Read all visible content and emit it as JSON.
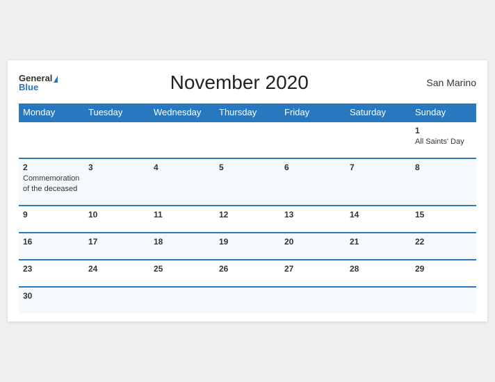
{
  "header": {
    "logo_general": "General",
    "logo_blue": "Blue",
    "title": "November 2020",
    "region": "San Marino"
  },
  "days_of_week": [
    "Monday",
    "Tuesday",
    "Wednesday",
    "Thursday",
    "Friday",
    "Saturday",
    "Sunday"
  ],
  "weeks": [
    [
      {
        "date": "",
        "event": ""
      },
      {
        "date": "",
        "event": ""
      },
      {
        "date": "",
        "event": ""
      },
      {
        "date": "",
        "event": ""
      },
      {
        "date": "",
        "event": ""
      },
      {
        "date": "",
        "event": ""
      },
      {
        "date": "1",
        "event": "All Saints' Day"
      }
    ],
    [
      {
        "date": "2",
        "event": "Commemoration of the deceased"
      },
      {
        "date": "3",
        "event": ""
      },
      {
        "date": "4",
        "event": ""
      },
      {
        "date": "5",
        "event": ""
      },
      {
        "date": "6",
        "event": ""
      },
      {
        "date": "7",
        "event": ""
      },
      {
        "date": "8",
        "event": ""
      }
    ],
    [
      {
        "date": "9",
        "event": ""
      },
      {
        "date": "10",
        "event": ""
      },
      {
        "date": "11",
        "event": ""
      },
      {
        "date": "12",
        "event": ""
      },
      {
        "date": "13",
        "event": ""
      },
      {
        "date": "14",
        "event": ""
      },
      {
        "date": "15",
        "event": ""
      }
    ],
    [
      {
        "date": "16",
        "event": ""
      },
      {
        "date": "17",
        "event": ""
      },
      {
        "date": "18",
        "event": ""
      },
      {
        "date": "19",
        "event": ""
      },
      {
        "date": "20",
        "event": ""
      },
      {
        "date": "21",
        "event": ""
      },
      {
        "date": "22",
        "event": ""
      }
    ],
    [
      {
        "date": "23",
        "event": ""
      },
      {
        "date": "24",
        "event": ""
      },
      {
        "date": "25",
        "event": ""
      },
      {
        "date": "26",
        "event": ""
      },
      {
        "date": "27",
        "event": ""
      },
      {
        "date": "28",
        "event": ""
      },
      {
        "date": "29",
        "event": ""
      }
    ],
    [
      {
        "date": "30",
        "event": ""
      },
      {
        "date": "",
        "event": ""
      },
      {
        "date": "",
        "event": ""
      },
      {
        "date": "",
        "event": ""
      },
      {
        "date": "",
        "event": ""
      },
      {
        "date": "",
        "event": ""
      },
      {
        "date": "",
        "event": ""
      }
    ]
  ]
}
